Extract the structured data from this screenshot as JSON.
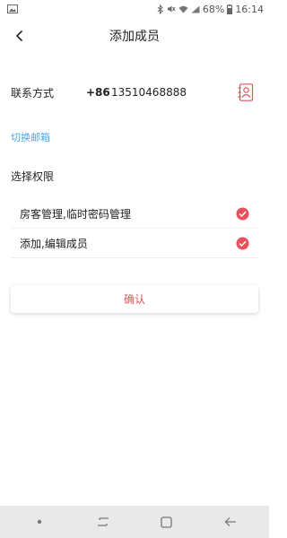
{
  "status_bar": {
    "battery": "68%",
    "time": "16:14"
  },
  "header": {
    "title": "添加成员",
    "back_icon": "chevron-left-icon"
  },
  "contact": {
    "label": "联系方式",
    "country_code": "+86",
    "phone_value": "13510468888",
    "contacts_icon": "address-book-icon"
  },
  "switch_link": "切换邮箱",
  "permissions": {
    "title": "选择权限",
    "items": [
      {
        "label": "房客管理,临时密码管理",
        "checked": true
      },
      {
        "label": "添加,编辑成员",
        "checked": true
      }
    ]
  },
  "confirm_label": "确认",
  "colors": {
    "accent": "#e8505b",
    "link": "#4aa8e8"
  }
}
